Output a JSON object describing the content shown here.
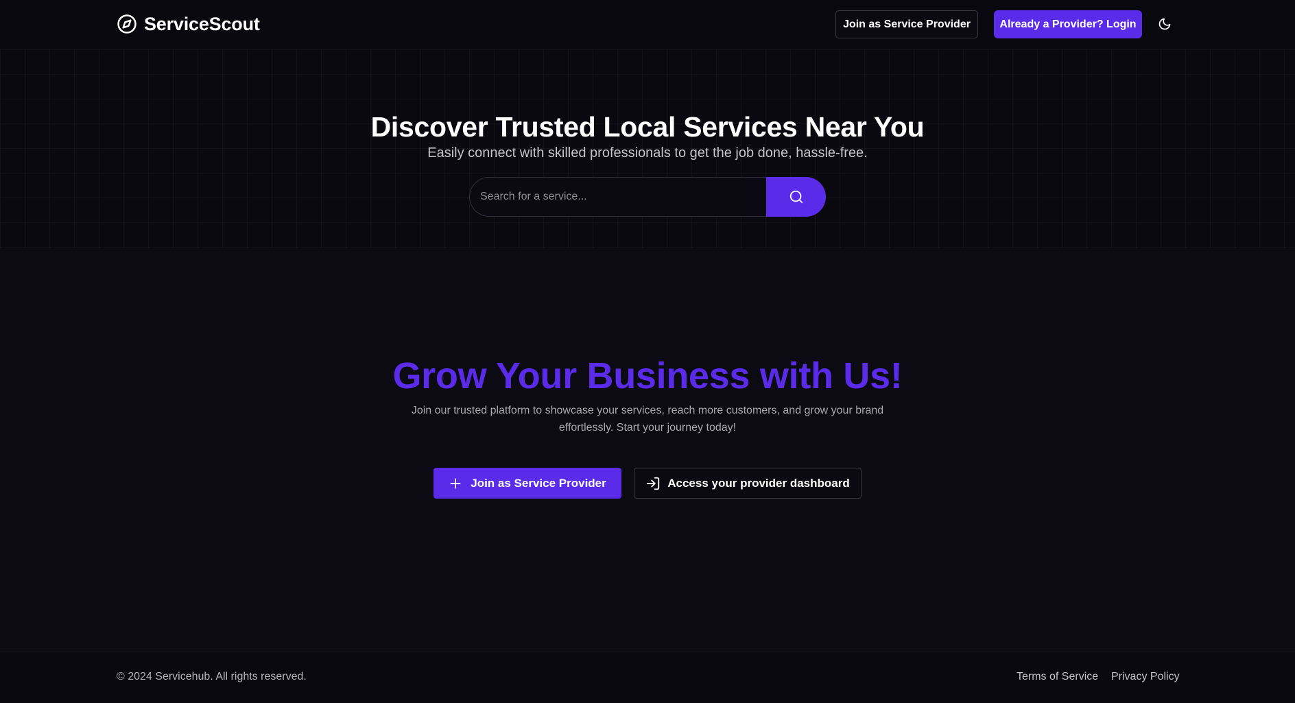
{
  "header": {
    "brand_name": "ServiceScout",
    "brand_icon": "compass-icon",
    "join_button": "Join as Service Provider",
    "login_button": "Already a Provider? Login",
    "theme_icon": "moon-icon"
  },
  "hero": {
    "title": "Discover Trusted Local Services Near You",
    "subtitle": "Easily connect with skilled professionals to get the job done, hassle-free.",
    "search_placeholder": "Search for a service...",
    "search_icon": "search-icon"
  },
  "grow": {
    "title": "Grow Your Business with Us!",
    "description": "Join our trusted platform to showcase your services, reach more customers, and grow your brand effortlessly. Start your journey today!",
    "join_button": "Join as Service Provider",
    "join_icon": "plus-icon",
    "dashboard_button": "Access your provider dashboard",
    "dashboard_icon": "login-arrow-icon"
  },
  "footer": {
    "copyright": "© 2024 Servicehub. All rights reserved.",
    "terms": "Terms of Service",
    "privacy": "Privacy Policy"
  },
  "colors": {
    "accent": "#5b2bea",
    "background": "#0b0a12",
    "text": "#ffffff",
    "muted_text": "#a9a9b3"
  }
}
